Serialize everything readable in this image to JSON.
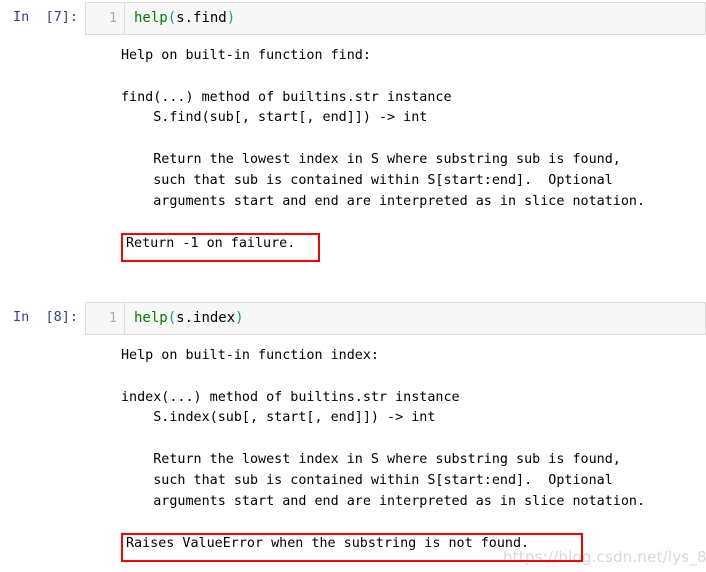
{
  "notebook": {
    "cells": [
      {
        "id": "cell-7",
        "prompt": "In  [7]:",
        "line_number": "1",
        "code": {
          "function_name": "help",
          "open_paren": "(",
          "argument": "s.find",
          "close_paren": ")",
          "full_text": "help(s.find)"
        },
        "output_top": "Help on built-in function find:\n\nfind(...) method of builtins.str instance\n    S.find(sub[, start[, end]]) -> int\n\n    Return the lowest index in S where substring sub is found,\n    such that sub is contained within S[start:end].  Optional\n    arguments start and end are interpreted as in slice notation.\n    ",
        "highlighted_line": "Return -1 on failure.",
        "output_bottom": ""
      },
      {
        "id": "cell-8",
        "prompt": "In  [8]:",
        "line_number": "1",
        "code": {
          "function_name": "help",
          "open_paren": "(",
          "argument": "s.index",
          "close_paren": ")",
          "full_text": "help(s.index)"
        },
        "output_top": "Help on built-in function index:\n\nindex(...) method of builtins.str instance\n    S.index(sub[, start[, end]]) -> int\n\n    Return the lowest index in S where substring sub is found,\n    such that sub is contained within S[start:end].  Optional\n    arguments start and end are interpreted as in slice notation.\n    ",
        "highlighted_line": "Raises ValueError when the substring is not found.",
        "output_bottom": ""
      }
    ]
  },
  "watermark": {
    "text": "https://blog.csdn.net/lys_828"
  },
  "colors": {
    "prompt_blue": "#303f9f",
    "highlight_red": "#fd0100",
    "code_bg": "#f7f7f7",
    "code_border": "#dddddd",
    "function_green": "#008000",
    "paren_teal": "#0aa07d",
    "linenum_gray": "#a8a8a8",
    "watermark_gray": "#d8d8d8"
  }
}
